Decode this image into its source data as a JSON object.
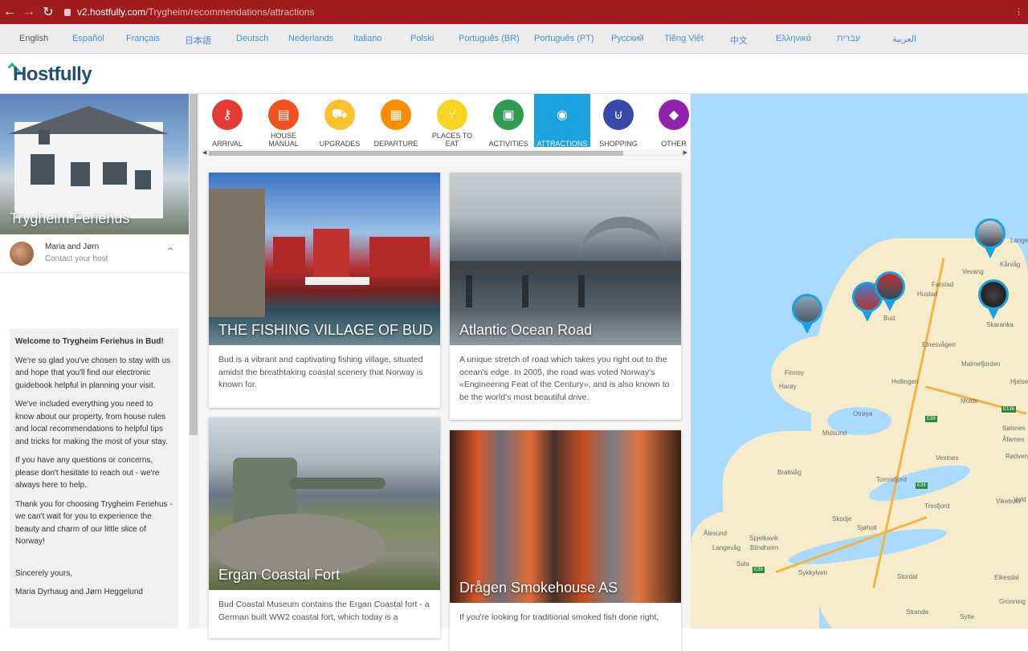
{
  "browser": {
    "url_host": "v2.hostfully.com",
    "url_path": "/Trygheim/recommendations/attractions"
  },
  "languages": [
    "English",
    "Español",
    "Français",
    "日本語",
    "Deutsch",
    "Nederlands",
    "Italiano",
    "Polski",
    "Português (BR)",
    "Português (PT)",
    "Русский",
    "Tiếng Việt",
    "中文",
    "Ελληνικά",
    "עברית",
    "العربية"
  ],
  "header": {
    "logo": "Hostfully"
  },
  "sidebar": {
    "property_name": "Trygheim Feriehus",
    "host_name": "Maria and Jørn",
    "host_action": "Contact your host",
    "welcome": {
      "title": "Welcome to Trygheim Feriehus in Bud!",
      "p1": "We're so glad you've chosen to stay with us and hope that you'll find our electronic guidebook helpful in planning your visit.",
      "p2": "We've included everything you need to know about our property, from house rules and local recommendations to helpful tips and tricks for making the most of your stay.",
      "p3": "If you have any questions or concerns, please don't hesitate to reach out - we're always here to help.",
      "p4": "Thank you for choosing Trygheim Feriehus - we can't wait for you to experience the beauty and charm of our little slice of Norway!",
      "sign1": "Sincerely yours,",
      "sign2": "Maria Dyrhaug and Jørn Heggelund"
    }
  },
  "tabs": [
    {
      "label": "ARRIVAL",
      "color": "#e53935",
      "icon": "key-icon",
      "glyph": "⚷"
    },
    {
      "label": "HOUSE MANUAL",
      "color": "#f4511e",
      "icon": "book-icon",
      "glyph": "▤"
    },
    {
      "label": "UPGRADES",
      "color": "#fbc02d",
      "icon": "cart-icon",
      "glyph": "⛟"
    },
    {
      "label": "DEPARTURE",
      "color": "#fb8c00",
      "icon": "clipboard-icon",
      "glyph": "▦"
    },
    {
      "label": "PLACES TO EAT",
      "color": "#f9d423",
      "icon": "fork-knife-icon",
      "glyph": "⑂"
    },
    {
      "label": "ACTIVITIES",
      "color": "#2e9d4f",
      "icon": "ticket-icon",
      "glyph": "▣"
    },
    {
      "label": "ATTRACTIONS",
      "color": "#1aa3e0",
      "icon": "camera-icon",
      "glyph": "◉"
    },
    {
      "label": "SHOPPING",
      "color": "#3949ab",
      "icon": "basket-icon",
      "glyph": "⊍"
    },
    {
      "label": "OTHER",
      "color": "#8e24aa",
      "icon": "tag-icon",
      "glyph": "◆"
    }
  ],
  "cards": [
    {
      "title": "THE FISHING VILLAGE OF BUD",
      "desc": "Bud is a vibrant and captivating fishing village, situated amidst the breathtaking coastal scenery that Norway is known for."
    },
    {
      "title": "Atlantic Ocean Road",
      "desc": "A unique stretch of road which takes you right out to the ocean's edge. In 2005, the road was voted Norway's «Engineering Feat of the Century», and is also known to be the world's most beautiful drive."
    },
    {
      "title": "Ergan Coastal Fort",
      "desc": "Bud Coastal Museum contains the Ergan Coastal fort - a German built WW2 coastal fort, which today is a"
    },
    {
      "title": "Drågen Smokehouse AS",
      "desc": "If you're looking for traditional smoked fish done right,"
    }
  ],
  "map": {
    "places": [
      "Vevang",
      "Kårvåg",
      "Farstad",
      "Hustad",
      "Bud",
      "Elnesvågen",
      "Malmefjorden",
      "Finnoy",
      "Harøy",
      "Hellingen",
      "Hjelset",
      "Molde",
      "Otrøya",
      "Midsund",
      "Sølsnes",
      "Åfarnes",
      "Vestnes",
      "Rødven",
      "Brattvåg",
      "Tomrefjord",
      "Tresfjord",
      "Vikebukt",
      "Skodje",
      "Sjøholt",
      "Ålesund",
      "Spjelkavik",
      "Langevåg",
      "Blindheim",
      "Sula",
      "Sykkylven",
      "Stordal",
      "Stranda",
      "Gronning",
      "Sylte",
      "Eikesdal",
      "Lange",
      "Vold",
      "Skaranka"
    ],
    "roads": [
      "E39",
      "E39",
      "E136",
      "E39"
    ]
  }
}
